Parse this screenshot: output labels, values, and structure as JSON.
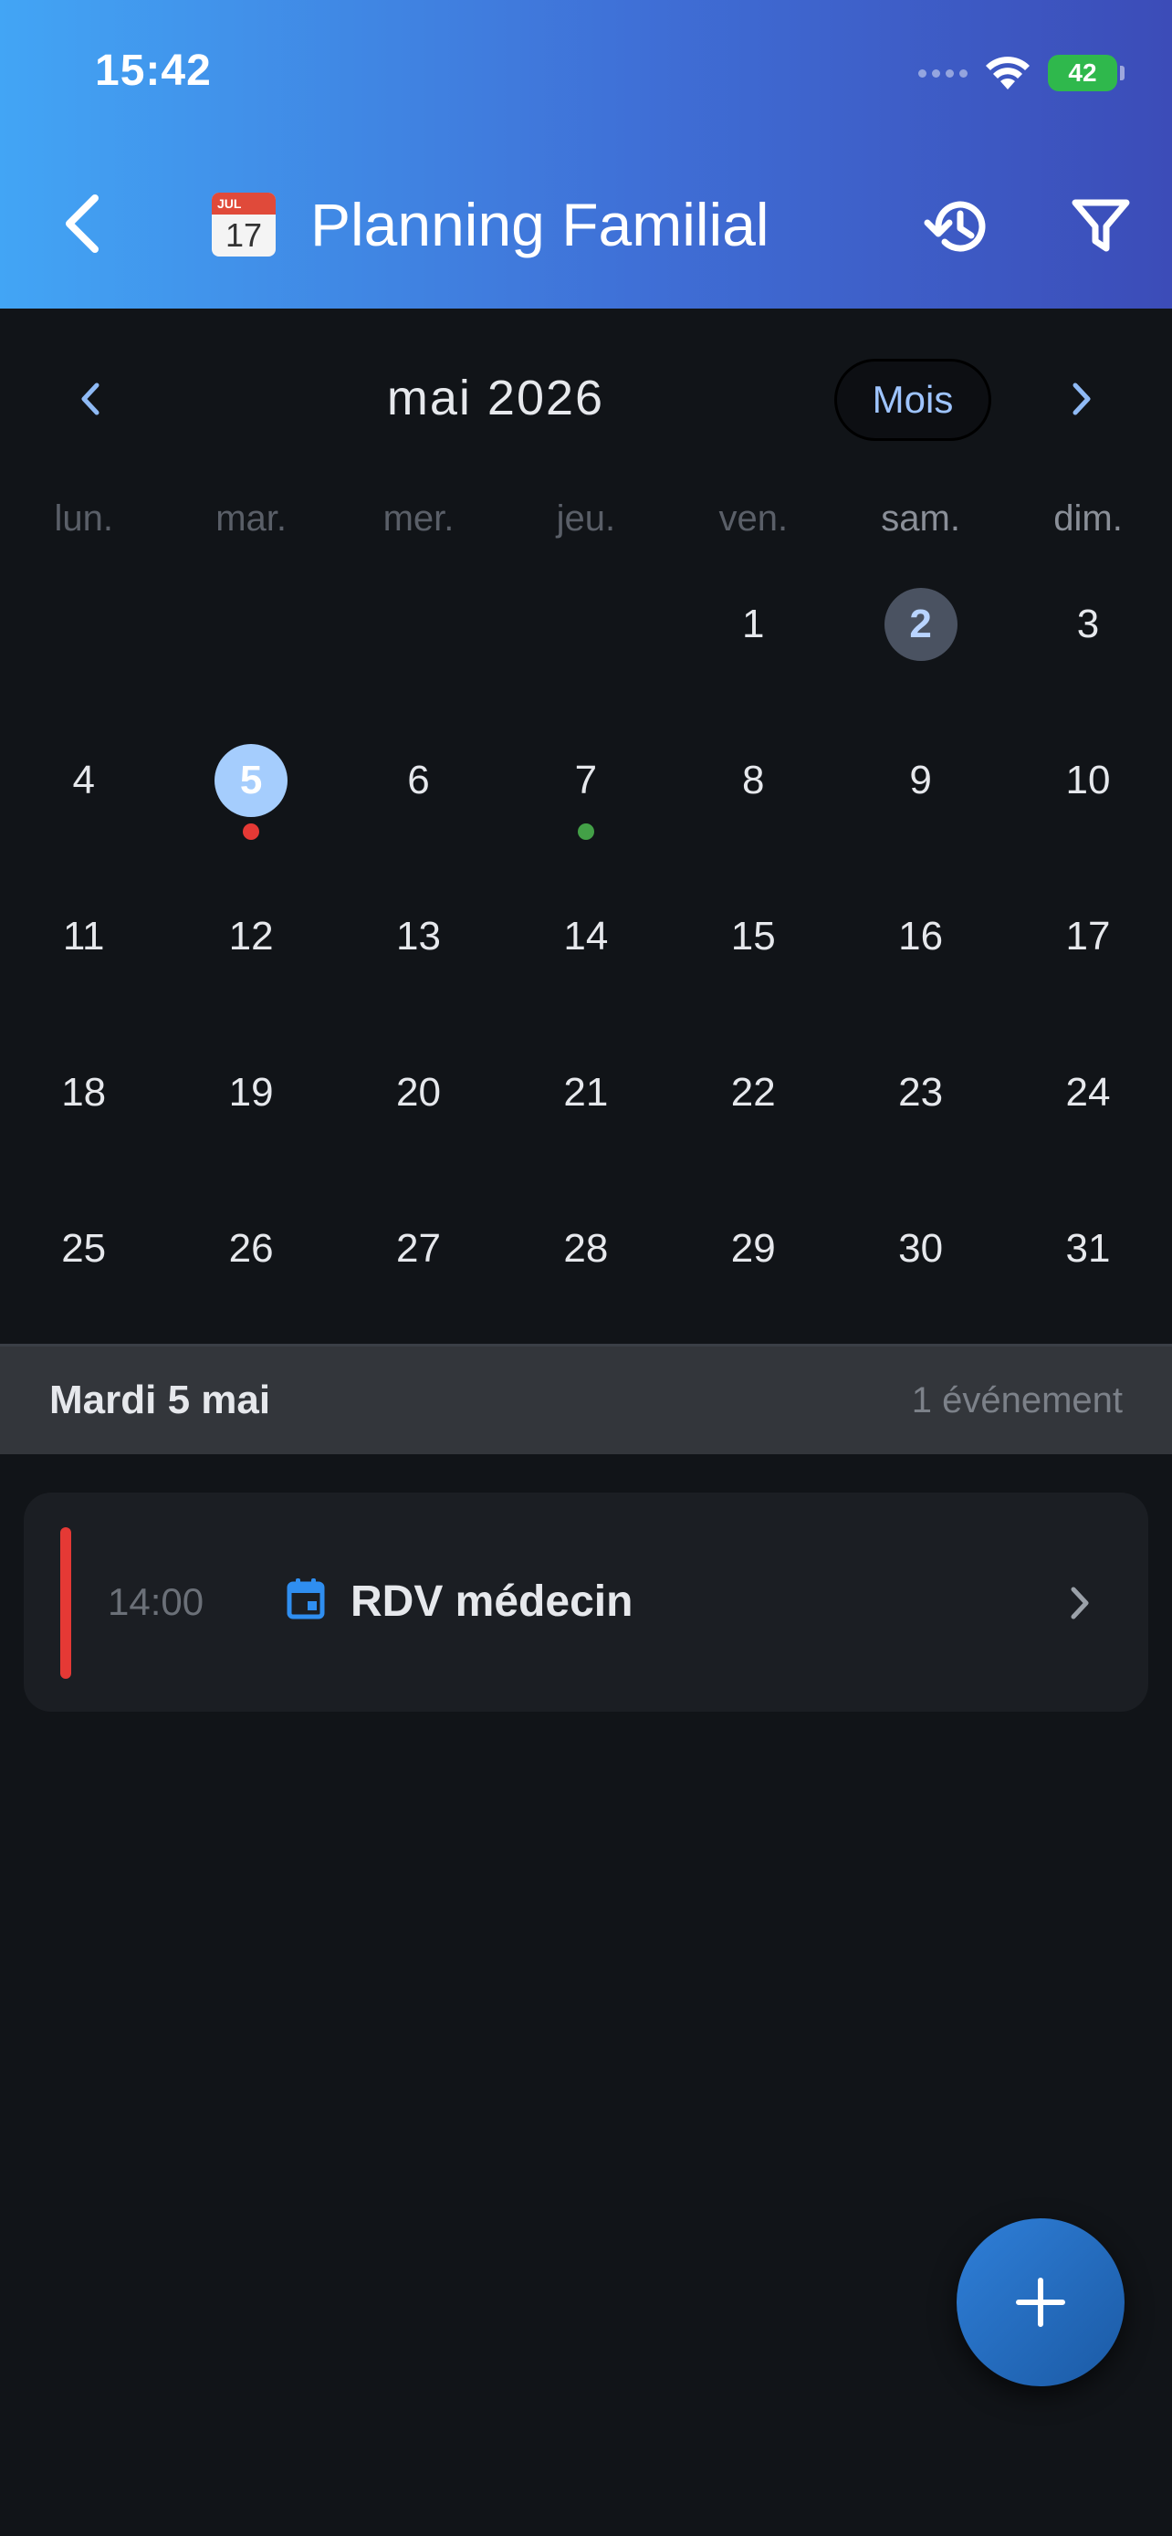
{
  "status_bar": {
    "time": "15:42",
    "battery": "42"
  },
  "header": {
    "title": "Planning Familial",
    "calendar_emoji_month": "JUL",
    "calendar_emoji_day": "17"
  },
  "calendar": {
    "month_label": "mai 2026",
    "view_mode": "Mois",
    "weekdays": [
      "lun.",
      "mar.",
      "mer.",
      "jeu.",
      "ven.",
      "sam.",
      "dim."
    ],
    "weeks": [
      [
        "",
        "",
        "",
        "",
        "1",
        "2",
        "3"
      ],
      [
        "4",
        "5",
        "6",
        "7",
        "8",
        "9",
        "10"
      ],
      [
        "11",
        "12",
        "13",
        "14",
        "15",
        "16",
        "17"
      ],
      [
        "18",
        "19",
        "20",
        "21",
        "22",
        "23",
        "24"
      ],
      [
        "25",
        "26",
        "27",
        "28",
        "29",
        "30",
        "31"
      ]
    ],
    "selected_day": "5",
    "today": "2",
    "event_dots": {
      "5": "#e53935",
      "7": "#43a047"
    }
  },
  "day_panel": {
    "title": "Mardi 5 mai",
    "count": "1 événement"
  },
  "events": [
    {
      "time": "14:00",
      "title": "RDV médecin",
      "color": "#e53935",
      "icon": "calendar-event-icon"
    }
  ],
  "colors": {
    "accent": "#a5cdfd",
    "header_start": "#42a5f5",
    "header_end": "#3c4cb8",
    "fab": "#2f7fd8"
  }
}
